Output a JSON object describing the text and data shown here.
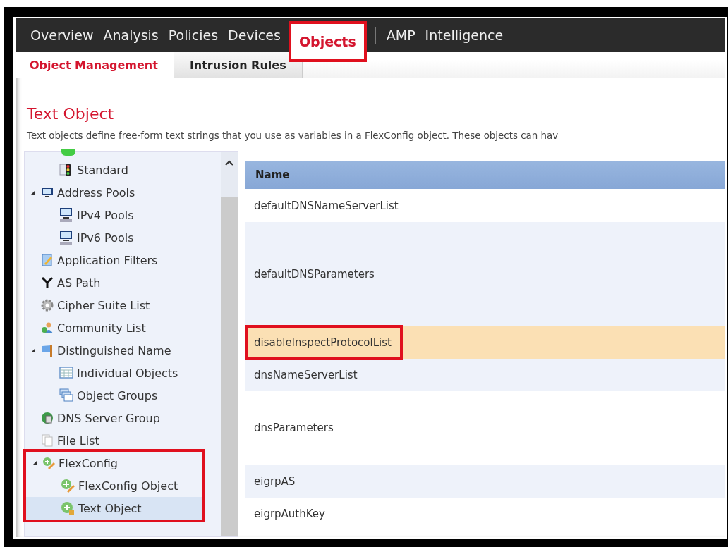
{
  "nav": [
    {
      "label": "Overview",
      "selected": false,
      "highlighted": false
    },
    {
      "label": "Analysis",
      "selected": false,
      "highlighted": false
    },
    {
      "label": "Policies",
      "selected": false,
      "highlighted": false
    },
    {
      "label": "Devices",
      "selected": false,
      "highlighted": false
    },
    {
      "label": "Objects",
      "selected": true,
      "highlighted": true
    },
    {
      "label": "AMP",
      "selected": false,
      "highlighted": false
    },
    {
      "label": "Intelligence",
      "selected": false,
      "highlighted": false
    }
  ],
  "subtabs": [
    {
      "label": "Object Management",
      "selected": true
    },
    {
      "label": "Intrusion Rules",
      "selected": false
    }
  ],
  "page": {
    "title": "Text Object",
    "description": "Text objects define free-form text strings that you use as variables in a FlexConfig object. These objects can hav"
  },
  "sidebar": {
    "tree": [
      {
        "highlighted": false,
        "children": [
          {
            "label": "Standard",
            "selected": false
          }
        ]
      },
      {
        "label": "Address Pools",
        "expanded": true,
        "selected": false,
        "highlighted": false,
        "children": [
          {
            "label": "IPv4 Pools",
            "selected": false
          },
          {
            "label": "IPv6 Pools",
            "selected": false
          }
        ]
      },
      {
        "label": "Application Filters",
        "selected": false,
        "highlighted": false
      },
      {
        "label": "AS Path",
        "selected": false,
        "highlighted": false
      },
      {
        "label": "Cipher Suite List",
        "selected": false,
        "highlighted": false
      },
      {
        "label": "Community List",
        "selected": false,
        "highlighted": false
      },
      {
        "label": "Distinguished Name",
        "expanded": true,
        "selected": false,
        "highlighted": false,
        "children": [
          {
            "label": "Individual Objects",
            "selected": false
          },
          {
            "label": "Object Groups",
            "selected": false
          }
        ]
      },
      {
        "label": "DNS Server Group",
        "selected": false,
        "highlighted": false
      },
      {
        "label": "File List",
        "selected": false,
        "highlighted": false
      },
      {
        "label": "FlexConfig",
        "expanded": true,
        "selected": false,
        "highlighted": true,
        "children": [
          {
            "label": "FlexConfig Object",
            "selected": false
          },
          {
            "label": "Text Object",
            "selected": true
          }
        ]
      }
    ]
  },
  "table": {
    "columns": [
      "Name"
    ],
    "rows": [
      {
        "name": "defaultDNSNameServerList",
        "selected": false,
        "highlighted": false
      },
      {
        "name": "defaultDNSParameters",
        "selected": false,
        "highlighted": false
      },
      {
        "name": "disableInspectProtocolList",
        "selected": true,
        "highlighted": true
      },
      {
        "name": "dnsNameServerList",
        "selected": false,
        "highlighted": false
      },
      {
        "name": "dnsParameters",
        "selected": false,
        "highlighted": false
      },
      {
        "name": "eigrpAS",
        "selected": false,
        "highlighted": false
      },
      {
        "name": "eigrpAuthKey",
        "selected": false,
        "highlighted": false
      }
    ]
  }
}
